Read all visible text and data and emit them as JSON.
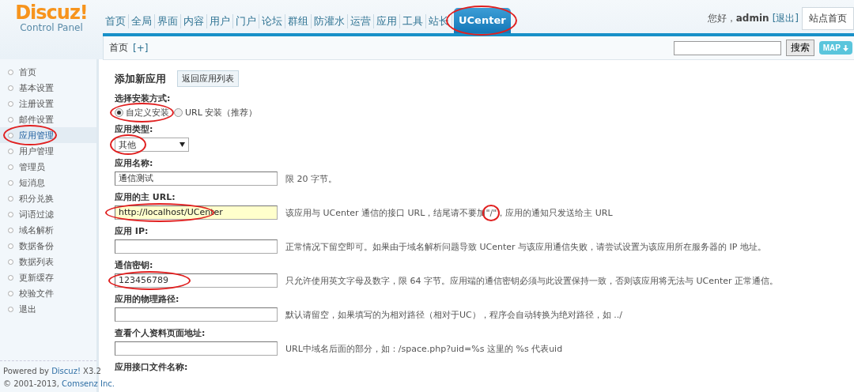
{
  "header": {
    "logo": {
      "title": "Discuz!",
      "subtitle": "Control Panel"
    },
    "nav": [
      {
        "label": "首页",
        "selected": false,
        "circled": false
      },
      {
        "label": "全局",
        "selected": false,
        "circled": false
      },
      {
        "label": "界面",
        "selected": false,
        "circled": false
      },
      {
        "label": "内容",
        "selected": false,
        "circled": false
      },
      {
        "label": "用户",
        "selected": false,
        "circled": false
      },
      {
        "label": "门户",
        "selected": false,
        "circled": false
      },
      {
        "label": "论坛",
        "selected": false,
        "circled": false
      },
      {
        "label": "群组",
        "selected": false,
        "circled": false
      },
      {
        "label": "防灌水",
        "selected": false,
        "circled": false
      },
      {
        "label": "运营",
        "selected": false,
        "circled": false
      },
      {
        "label": "应用",
        "selected": false,
        "circled": false
      },
      {
        "label": "工具",
        "selected": false,
        "circled": false
      },
      {
        "label": "站长",
        "selected": false,
        "circled": false
      },
      {
        "label": "UCenter",
        "selected": true,
        "circled": true
      }
    ],
    "greeting": "您好，",
    "user": "admin",
    "logout": "[退出]",
    "site_menu": "站点首页"
  },
  "toolbar": {
    "breadcrumb": "首页",
    "add": "[+]",
    "search_button": "搜索",
    "map_button": "MAP"
  },
  "sidebar": {
    "items": [
      {
        "label": "首页",
        "selected": false,
        "circled": false
      },
      {
        "label": "基本设置",
        "selected": false,
        "circled": false
      },
      {
        "label": "注册设置",
        "selected": false,
        "circled": false
      },
      {
        "label": "邮件设置",
        "selected": false,
        "circled": false
      },
      {
        "label": "应用管理",
        "selected": true,
        "circled": true
      },
      {
        "label": "用户管理",
        "selected": false,
        "circled": false
      },
      {
        "label": "管理员",
        "selected": false,
        "circled": false
      },
      {
        "label": "短消息",
        "selected": false,
        "circled": false
      },
      {
        "label": "积分兑换",
        "selected": false,
        "circled": false
      },
      {
        "label": "词语过滤",
        "selected": false,
        "circled": false
      },
      {
        "label": "域名解析",
        "selected": false,
        "circled": false
      },
      {
        "label": "数据备份",
        "selected": false,
        "circled": false
      },
      {
        "label": "数据列表",
        "selected": false,
        "circled": false
      },
      {
        "label": "更新缓存",
        "selected": false,
        "circled": false
      },
      {
        "label": "校验文件",
        "selected": false,
        "circled": false
      },
      {
        "label": "退出",
        "selected": false,
        "circled": false
      }
    ],
    "powered": {
      "text": "Powered by",
      "link": "Discuz!",
      "suffix": "X3.2"
    },
    "copyright": {
      "text": "© 2001-2013,",
      "link": "Comsenz Inc."
    }
  },
  "form": {
    "title": "添加新应用",
    "back_button": "返回应用列表",
    "fields": [
      {
        "kind": "radio",
        "label": "选择安装方式:",
        "options": [
          {
            "label": "自定义安装",
            "selected": true,
            "circled": true
          },
          {
            "label": "URL 安装（推荐）",
            "selected": false,
            "circled": false
          }
        ]
      },
      {
        "kind": "select",
        "label": "应用类型:",
        "value": "其他",
        "circled": true
      },
      {
        "kind": "text",
        "label": "应用名称:",
        "value": "通信测试",
        "highlighted": false,
        "hint": [
          {
            "text": "限 20 字节。"
          }
        ]
      },
      {
        "kind": "text",
        "label": "应用的主 URL:",
        "value": "http://localhost/UCenter",
        "highlighted": true,
        "circled": true,
        "hint": [
          {
            "text": "该应用与 UCenter 通信的接口 URL，结尾请不要加"
          },
          {
            "text": "\"/\"",
            "circled": true
          },
          {
            "text": "，应用的通知只发送给主 URL"
          }
        ]
      },
      {
        "kind": "text",
        "label": "应用 IP:",
        "highlighted": false,
        "hint": [
          {
            "text": "正常情况下留空即可。如果由于域名解析问题导致 UCenter 与该应用通信失败，请尝试设置为该应用所在服务器的 IP 地址。"
          }
        ]
      },
      {
        "kind": "text",
        "label": "通信密钥:",
        "value": "123456789",
        "highlighted": false,
        "circled": true,
        "hint": [
          {
            "text": "只允许使用英文字母及数字，限 64 字节。应用端的通信密钥必须与此设置保持一致，否则该应用将无法与 UCenter 正常通信。"
          }
        ]
      },
      {
        "kind": "text",
        "label": "应用的物理路径:",
        "highlighted": false,
        "hint": [
          {
            "text": "默认请留空，如果填写的为相对路径（相对于UC），程序会自动转换为绝对路径，如 ../"
          }
        ]
      },
      {
        "kind": "text",
        "label": "查看个人资料页面地址:",
        "highlighted": false,
        "hint": [
          {
            "text": "URL中域名后面的部分，如：/space.php?uid=%s 这里的 %s 代表uid"
          }
        ]
      },
      {
        "kind": "label",
        "label": "应用接口文件名称:"
      }
    ]
  }
}
